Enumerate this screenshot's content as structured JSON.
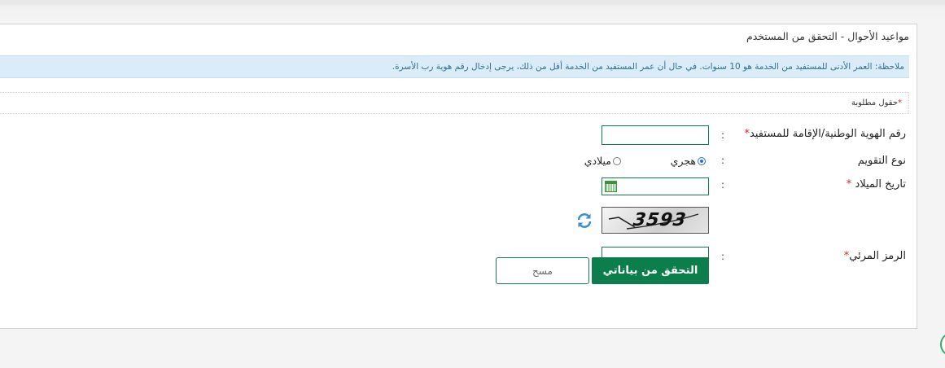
{
  "panel": {
    "title": "مواعيد الأحوال - التحقق من المستخدم"
  },
  "note": {
    "text": "ملاحظة: العمر الأدنى للمستفيد من الخدمة هو 10 سنوات. في حال أن عمر المستفيد من الخدمة أقل من ذلك، يرجى إدخال رقم هوية رب الأسرة."
  },
  "required": {
    "star": "*",
    "label": "حقول مطلوبة"
  },
  "form": {
    "colon": ":",
    "id_field": {
      "label": "رقم الهوية الوطنية/الإقامة للمستفيد",
      "star": "*",
      "value": ""
    },
    "calendar": {
      "label": "نوع التقويم",
      "options": [
        {
          "label": "هجري",
          "selected": true
        },
        {
          "label": "ميلادي",
          "selected": false
        }
      ]
    },
    "birth_date": {
      "label": "تاريخ الميلاد",
      "star": "*",
      "value": ""
    },
    "captcha": {
      "image_text": "3593"
    },
    "visual_code": {
      "label": "الرمز المرئي",
      "star": "*",
      "value": ""
    }
  },
  "buttons": {
    "verify": "التحقق من بياناتي",
    "clear": "مسح"
  },
  "colors": {
    "primary": "#0c7e4b",
    "note_bg": "#d9ecf7",
    "note_text": "#31708f",
    "required_star": "#d9262b"
  }
}
